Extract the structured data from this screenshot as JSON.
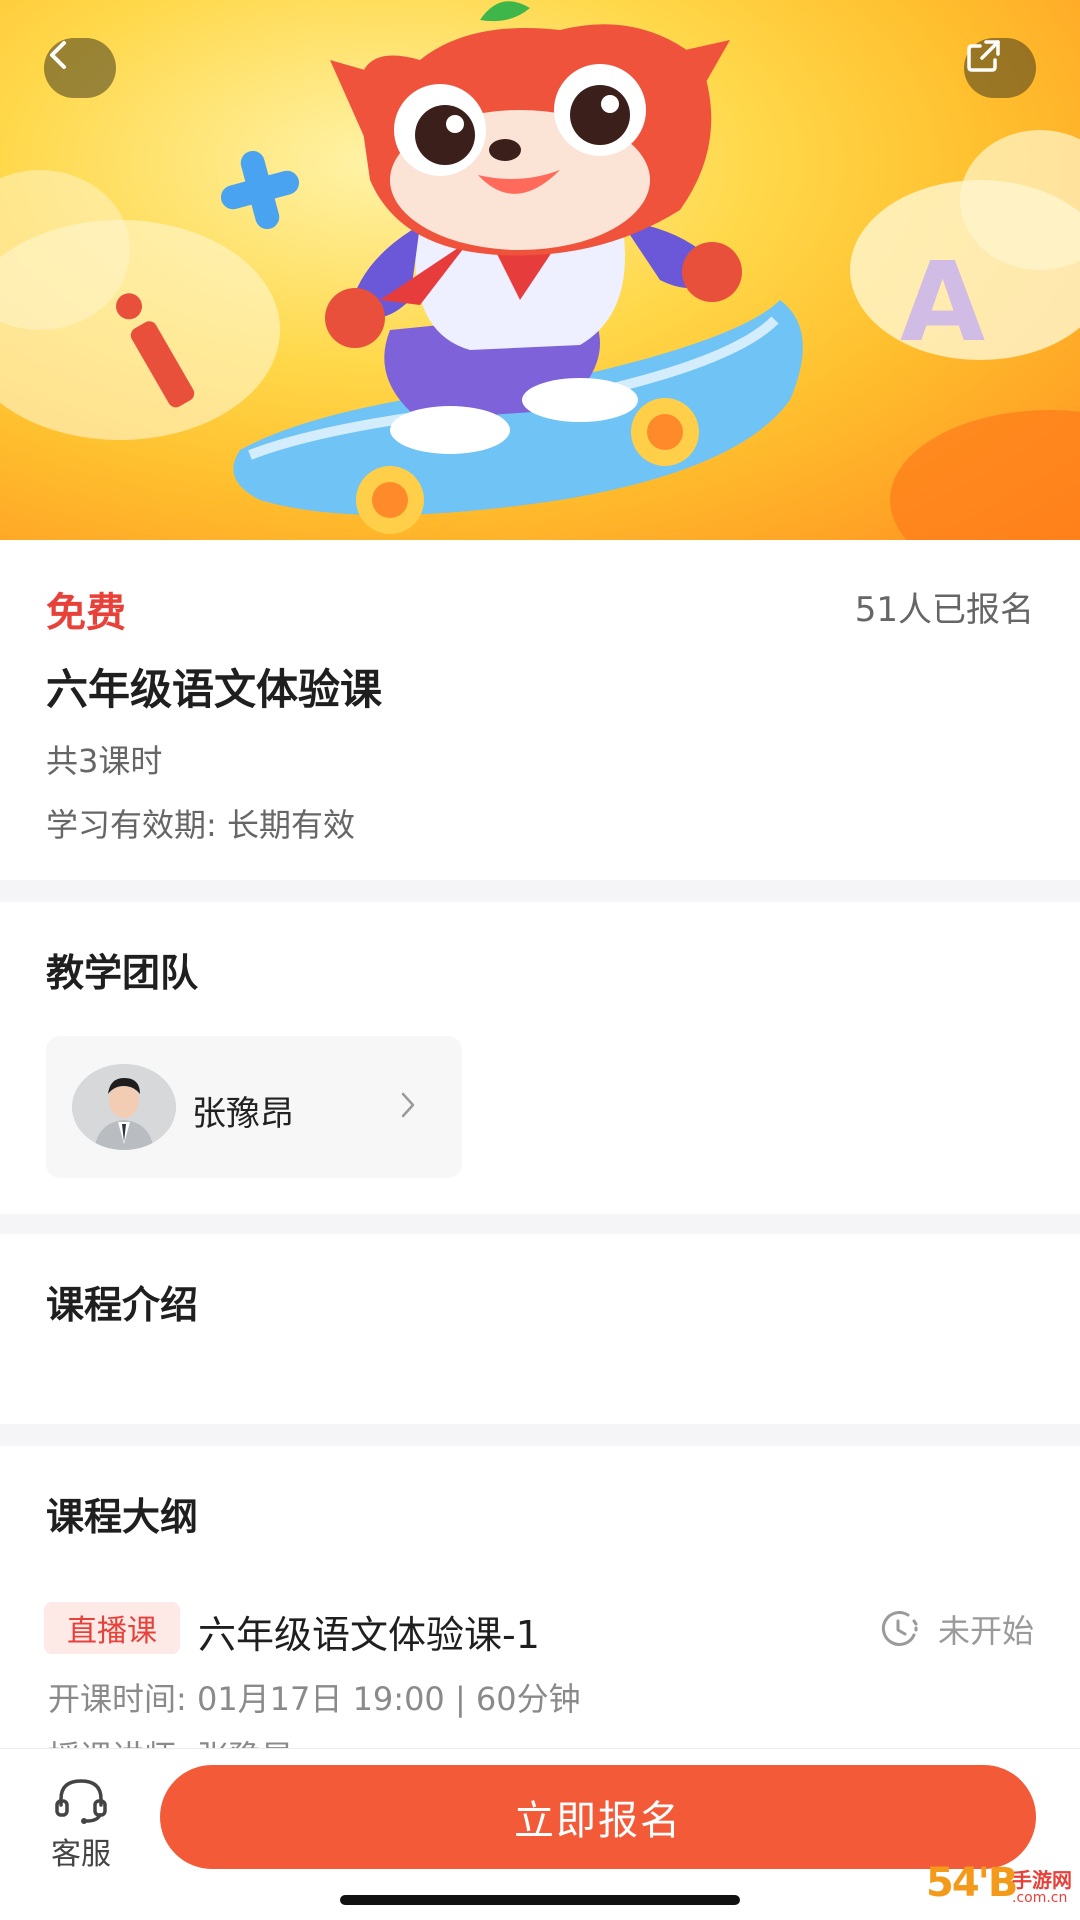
{
  "hero": {
    "illustration": "fox-mascot-on-hoverboard",
    "back_icon": "chevron-left-icon",
    "share_icon": "share-icon",
    "letters": [
      "A",
      "i"
    ]
  },
  "course": {
    "price": "免费",
    "enrolled": "51人已报名",
    "title": "六年级语文体验课",
    "lessons": "共3课时",
    "validity": "学习有效期: 长期有效"
  },
  "team": {
    "title": "教学团队",
    "teacher": {
      "name": "张豫昂",
      "avatar": "teacher-avatar"
    }
  },
  "intro": {
    "title": "课程介绍"
  },
  "outline": {
    "title": "课程大纲",
    "lessons": [
      {
        "tag": "直播课",
        "title": "六年级语文体验课-1",
        "status": "未开始",
        "time": "开课时间:  01月17日 19:00 | 60分钟",
        "teacher": "授课讲师:  张豫昂"
      }
    ]
  },
  "bottom": {
    "service_label": "客服",
    "enroll_label": "立即报名"
  },
  "watermark": {
    "num": "54'B",
    "cn": "手游网",
    "url": ".com.cn"
  },
  "colors": {
    "accent": "#e8413a",
    "button": "#f25a38",
    "tag_bg": "#fde9e6",
    "divider": "#f5f5f7"
  }
}
